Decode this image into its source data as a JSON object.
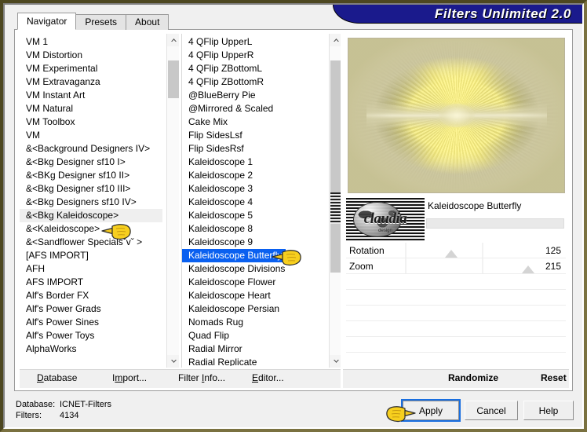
{
  "window": {
    "title": "Filters Unlimited 2.0"
  },
  "tabs": [
    {
      "label": "Navigator",
      "active": true
    },
    {
      "label": "Presets",
      "active": false
    },
    {
      "label": "About",
      "active": false
    }
  ],
  "category_list": {
    "name": "category-list",
    "items": [
      "VM 1",
      "VM Distortion",
      "VM Experimental",
      "VM Extravaganza",
      "VM Instant Art",
      "VM Natural",
      "VM Toolbox",
      "VM",
      "&<Background Designers IV>",
      "&<Bkg Designer sf10 I>",
      "&<BKg Designer sf10 II>",
      "&<Bkg Designer sf10 III>",
      "&<Bkg Designers sf10 IV>",
      "&<Bkg Kaleidoscope>",
      "&<Kaleidoscope>",
      "&<Sandflower Specialsˇvˇ >",
      "[AFS IMPORT]",
      "AFH",
      "AFS IMPORT",
      "Alf's Border FX",
      "Alf's Power Grads",
      "Alf's Power Sines",
      "Alf's Power Toys",
      "AlphaWorks"
    ],
    "hovered": "&<Bkg Kaleidoscope>"
  },
  "filter_list": {
    "name": "filter-list",
    "items": [
      "4 QFlip UpperL",
      "4 QFlip UpperR",
      "4 QFlip ZBottomL",
      "4 QFlip ZBottomR",
      "@BlueBerry Pie",
      "@Mirrored & Scaled",
      "Cake Mix",
      "Flip SidesLsf",
      "Flip SidesRsf",
      "Kaleidoscope 1",
      "Kaleidoscope 2",
      "Kaleidoscope 3",
      "Kaleidoscope 4",
      "Kaleidoscope 5",
      "Kaleidoscope 8",
      "Kaleidoscope 9",
      "Kaleidoscope Butterfly",
      "Kaleidoscope Divisions",
      "Kaleidoscope Flower",
      "Kaleidoscope Heart",
      "Kaleidoscope Persian",
      "Nomads Rug",
      "Quad Flip",
      "Radial Mirror",
      "Radial Replicate"
    ],
    "selected": "Kaleidoscope Butterfly",
    "selected_index": 16
  },
  "preview": {
    "name": "filter-preview",
    "alt": "Kaleidoscope butterfly pattern preview"
  },
  "logo": {
    "text": "claudia",
    "subtext": "design"
  },
  "filter_title": "Kaleidoscope Butterfly",
  "parameters": [
    {
      "label": "Rotation",
      "value": "125",
      "thumb_pct": 48
    },
    {
      "label": "Zoom",
      "value": "215",
      "thumb_pct": 83
    }
  ],
  "link_bar": {
    "database": {
      "pre": "D",
      "post": "atabase"
    },
    "import": {
      "pre": "I",
      "mid": "m",
      "post": "port..."
    },
    "filter_info": {
      "pre": "Filter ",
      "accel": "I",
      "post": "nfo..."
    },
    "editor": {
      "pre": "E",
      "post": "ditor..."
    }
  },
  "right_link_bar": {
    "randomize": "Randomize",
    "reset": "Reset"
  },
  "status": {
    "database_label": "Database:",
    "database_value": "ICNET-Filters",
    "filters_label": "Filters:",
    "filters_value": "4134"
  },
  "dialog_buttons": {
    "apply": "Apply",
    "cancel": "Cancel",
    "help": "Help"
  },
  "colors": {
    "title_bar": "#1a1a8c",
    "selection": "#0a60f0",
    "frame": "#5d5526",
    "focus_outline": "#1a6fe0",
    "cursor_yellow": "#f7cf1e"
  }
}
